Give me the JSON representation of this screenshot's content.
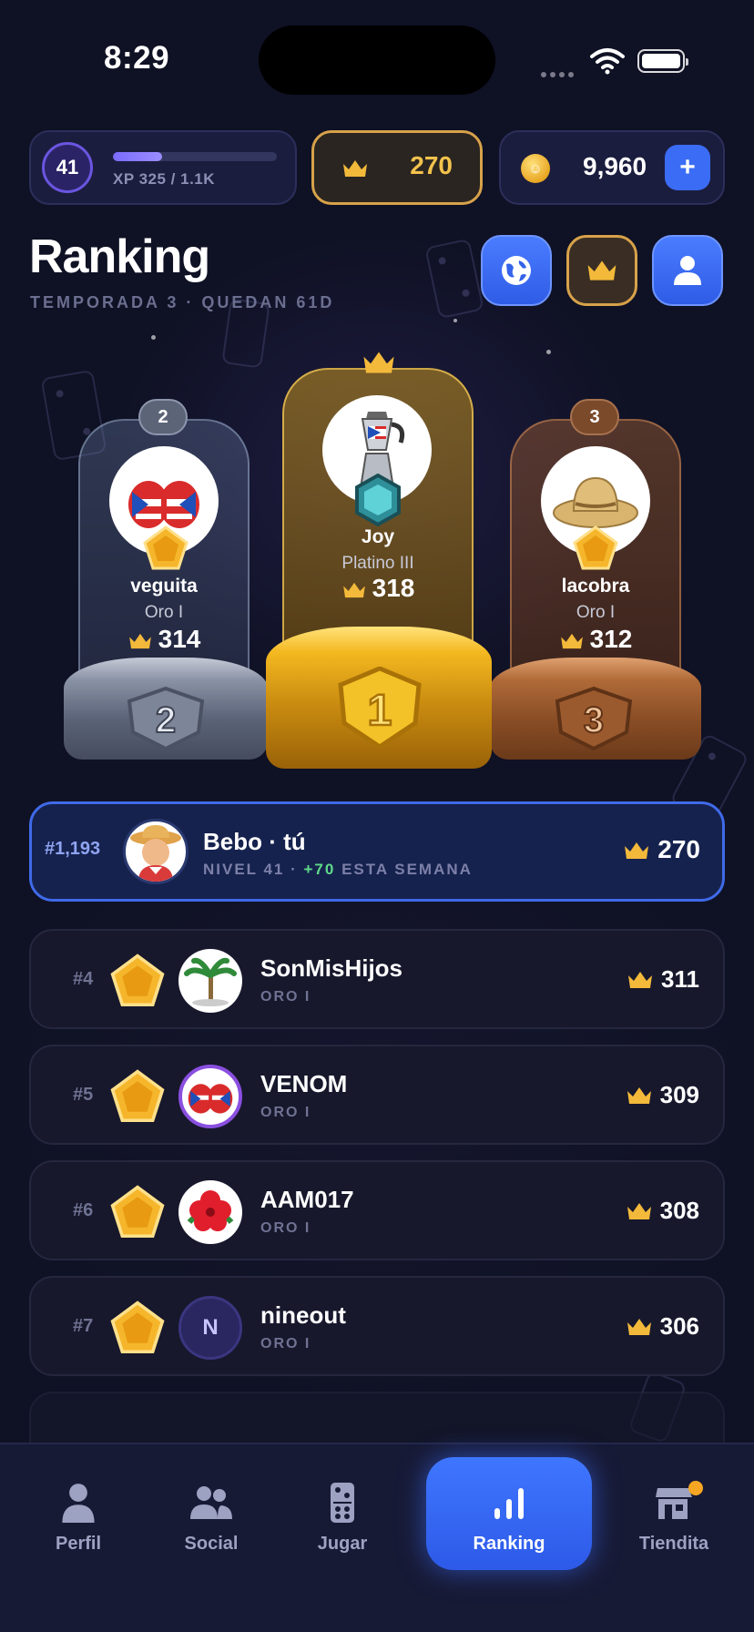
{
  "status_bar": {
    "time": "8:29"
  },
  "header": {
    "level": "41",
    "xp_text": "XP 325 / 1.1K",
    "xp_progress": 0.3,
    "crowns": "270",
    "coins": "9,960",
    "add_label": "+"
  },
  "page": {
    "title": "Ranking",
    "subtitle": "TEMPORADA 3 · QUEDAN 61D"
  },
  "podium": [
    {
      "rank": "1",
      "name": "Joy",
      "tier": "Platino III",
      "score": "318"
    },
    {
      "rank": "2",
      "name": "veguita",
      "tier": "Oro I",
      "score": "314"
    },
    {
      "rank": "3",
      "name": "lacobra",
      "tier": "Oro I",
      "score": "312"
    }
  ],
  "me": {
    "rank": "#1,193",
    "name": "Bebo · tú",
    "sub_level": "NIVEL 41 · ",
    "sub_gain": "+70",
    "sub_rest": " ESTA SEMANA",
    "score": "270"
  },
  "leaderboard": [
    {
      "rank": "#4",
      "name": "SonMisHijos",
      "tier": "ORO I",
      "score": "311"
    },
    {
      "rank": "#5",
      "name": "VENOM",
      "tier": "ORO I",
      "score": "309"
    },
    {
      "rank": "#6",
      "name": "AAM017",
      "tier": "ORO I",
      "score": "308"
    },
    {
      "rank": "#7",
      "name": "nineout",
      "tier": "ORO I",
      "score": "306",
      "initial": "N"
    }
  ],
  "tabs": [
    {
      "label": "Perfil",
      "icon": "person-icon"
    },
    {
      "label": "Social",
      "icon": "people-icon"
    },
    {
      "label": "Jugar",
      "icon": "domino-icon"
    },
    {
      "label": "Ranking",
      "icon": "bar-chart-icon",
      "active": true
    },
    {
      "label": "Tiendita",
      "icon": "shop-icon"
    }
  ],
  "colors": {
    "background": "#0f1124",
    "accent_blue": "#3b6cf5",
    "gold": "#f3c24d",
    "silver": "#8a92a6",
    "bronze": "#b06a38",
    "gain_green": "#5fd98a"
  }
}
